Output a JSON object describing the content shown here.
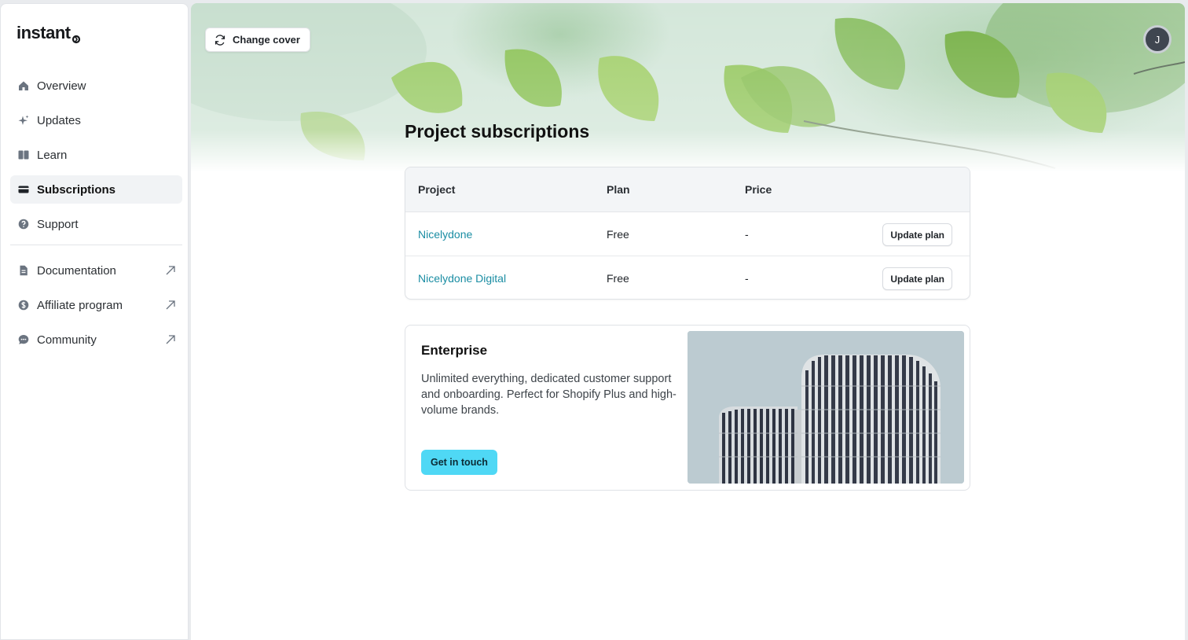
{
  "brand": {
    "logo_text": "instant"
  },
  "sidebar": {
    "items": [
      {
        "label": "Overview",
        "icon": "home-icon",
        "active": false
      },
      {
        "label": "Updates",
        "icon": "sparkle-icon",
        "active": false
      },
      {
        "label": "Learn",
        "icon": "book-icon",
        "active": false
      },
      {
        "label": "Subscriptions",
        "icon": "credit-card-icon",
        "active": true
      },
      {
        "label": "Support",
        "icon": "help-circle-icon",
        "active": false
      }
    ],
    "external_items": [
      {
        "label": "Documentation",
        "icon": "document-icon"
      },
      {
        "label": "Affiliate program",
        "icon": "dollar-circle-icon"
      },
      {
        "label": "Community",
        "icon": "chat-bubble-icon"
      }
    ]
  },
  "header": {
    "change_cover_label": "Change cover",
    "avatar_initial": "J"
  },
  "main": {
    "title": "Project subscriptions",
    "table": {
      "columns": [
        "Project",
        "Plan",
        "Price"
      ],
      "rows": [
        {
          "project": "Nicelydone",
          "plan": "Free",
          "price": "-",
          "action": "Update plan"
        },
        {
          "project": "Nicelydone Digital",
          "plan": "Free",
          "price": "-",
          "action": "Update plan"
        }
      ]
    },
    "enterprise": {
      "title": "Enterprise",
      "description": "Unlimited everything, dedicated customer support and onboarding. Perfect for Shopify Plus and high-volume brands.",
      "cta_label": "Get in touch"
    }
  },
  "colors": {
    "accent_cyan": "#4fd8f5",
    "link": "#1a8da3",
    "active_nav_bg": "#f1f3f5"
  }
}
